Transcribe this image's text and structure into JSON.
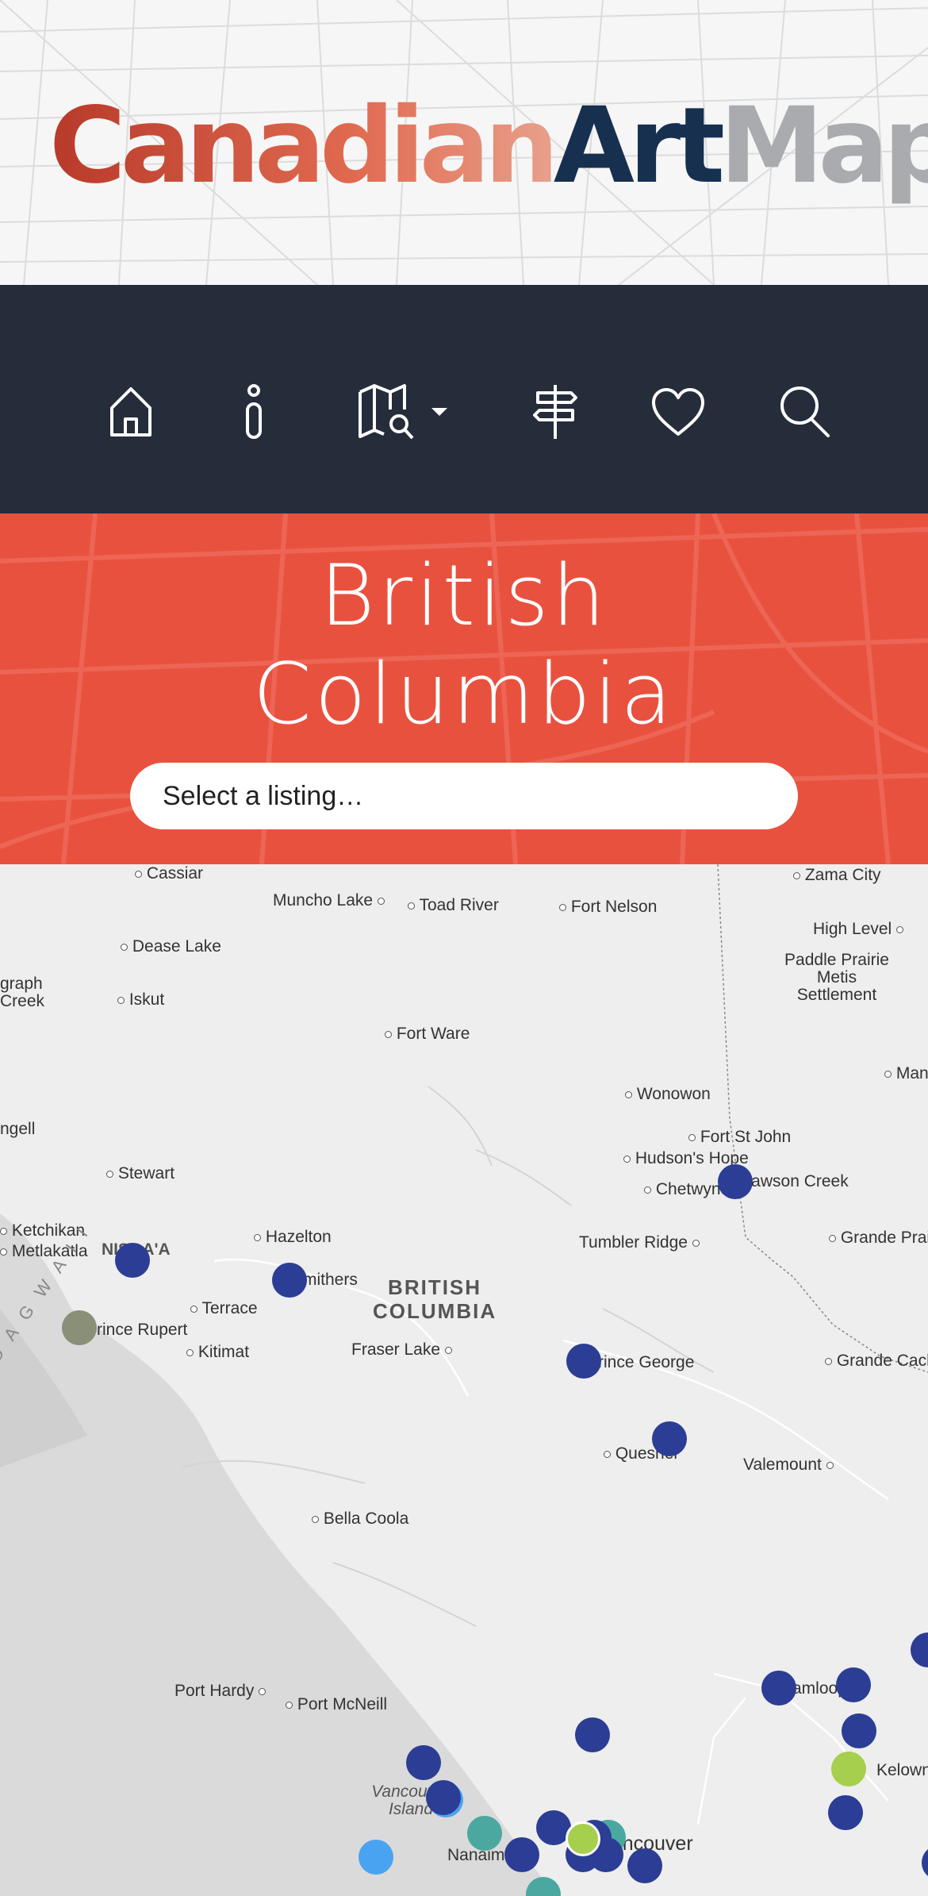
{
  "header": {
    "logo_part1": "Canadian",
    "logo_part2": "Art",
    "logo_part3": "Map"
  },
  "nav": {
    "items": [
      {
        "icon": "home-icon"
      },
      {
        "icon": "info-icon"
      },
      {
        "icon": "map-search-icon",
        "dropdown": true
      },
      {
        "icon": "signpost-icon"
      },
      {
        "icon": "heart-icon"
      },
      {
        "icon": "search-icon"
      }
    ]
  },
  "hero": {
    "title_line1": "British",
    "title_line2": "Columbia",
    "select_placeholder": "Select a listing…"
  },
  "map": {
    "region_label_line1": "BRITISH",
    "region_label_line2": "COLUMBIA",
    "island_label": "H A I D A   G W A I I",
    "places": {
      "cassiar": "Cassiar",
      "muncho_lake": "Muncho Lake",
      "toad_river": "Toad River",
      "fort_nelson": "Fort Nelson",
      "zama_city": "Zama City",
      "high_level": "High Level",
      "paddle_prairie": "Paddle Prairie Metis Settlement",
      "dease_lake": "Dease Lake",
      "graph_creek": "graph Creek",
      "iskut": "Iskut",
      "fort_ware": "Fort Ware",
      "wonowon": "Wonowon",
      "man": "Man",
      "ngell": "ngell",
      "fort_st_john": "Fort St John",
      "hudsons_hope": "Hudson's Hope",
      "chetwynd": "Chetwynd",
      "dawson_creek": "Dawson Creek",
      "stewart": "Stewart",
      "ketchikan": "Ketchikan",
      "metlakatla": "Metlakatla",
      "nisgaa": "NISGA'A",
      "hazelton": "Hazelton",
      "tumbler_ridge": "Tumbler Ridge",
      "grande_prairie": "Grande Prai",
      "smithers": "Smithers",
      "terrace": "Terrace",
      "prince_rupert": "Prince Rupert",
      "kitimat": "Kitimat",
      "fraser_lake": "Fraser Lake",
      "prince_george": "Prince George",
      "grande_cache": "Grande Cach",
      "quesnel": "Quesnel",
      "valemount": "Valemount",
      "bella_coola": "Bella Coola",
      "port_hardy": "Port Hardy",
      "port_mcneill": "Port McNeill",
      "kamloops": "Kamloops",
      "vancouver_island": "Vancouver Island",
      "kelowna": "Kelowna",
      "nanaimo": "Nanaimo",
      "vancouver": "Vancouver"
    }
  },
  "colors": {
    "nav_bg": "#252d3b",
    "hero_bg": "#e9513f",
    "marker_navy": "#2b3d94",
    "marker_teal": "#4aa8a0",
    "marker_lime": "#a5cf4c",
    "marker_lightblue": "#4aa3f0",
    "marker_olive": "#8a8f78"
  }
}
